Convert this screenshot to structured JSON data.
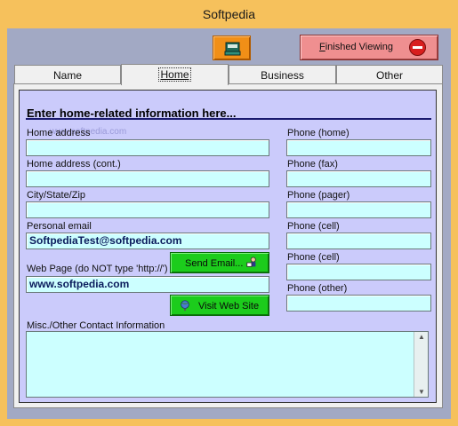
{
  "window": {
    "title": "Softpedia"
  },
  "toolbar": {
    "finish_prefix": "F",
    "finish_rest": "inished Viewing"
  },
  "tabs": [
    "Name",
    "Home",
    "Business",
    "Other"
  ],
  "heading": "Enter home-related information here...",
  "watermark": "www.softpedia.com",
  "left_fields": {
    "home_address": {
      "label": "Home address",
      "value": ""
    },
    "home_address_cont": {
      "label": "Home address (cont.)",
      "value": ""
    },
    "city_state_zip": {
      "label": "City/State/Zip",
      "value": ""
    },
    "personal_email": {
      "label": "Personal email",
      "value": "SoftpediaTest@softpedia.com"
    },
    "web_page": {
      "label": "Web Page (do NOT type 'http://')",
      "value": "www.softpedia.com"
    }
  },
  "buttons": {
    "send_email": "Send Email...",
    "visit_site": "Visit Web Site"
  },
  "right_fields": [
    {
      "label": "Phone (home)",
      "value": ""
    },
    {
      "label": "Phone (fax)",
      "value": ""
    },
    {
      "label": "Phone (pager)",
      "value": ""
    },
    {
      "label": "Phone (cell)",
      "value": ""
    },
    {
      "label": "Phone (cell)",
      "value": ""
    },
    {
      "label": "Phone (other)",
      "value": ""
    }
  ],
  "misc": {
    "label": "Misc./Other Contact Information",
    "value": ""
  },
  "colors": {
    "frame": "#f6c15c",
    "panel": "#cbcbfb",
    "field": "#ccffff",
    "green_button": "#1ccc1c",
    "finish_button": "#ef8f90",
    "contact_button": "#f18f17"
  },
  "icons": {
    "contact_button": "address-book-icon",
    "finish": "no-entry-icon",
    "send_email": "mail-person-icon",
    "visit_site": "globe-icon"
  }
}
